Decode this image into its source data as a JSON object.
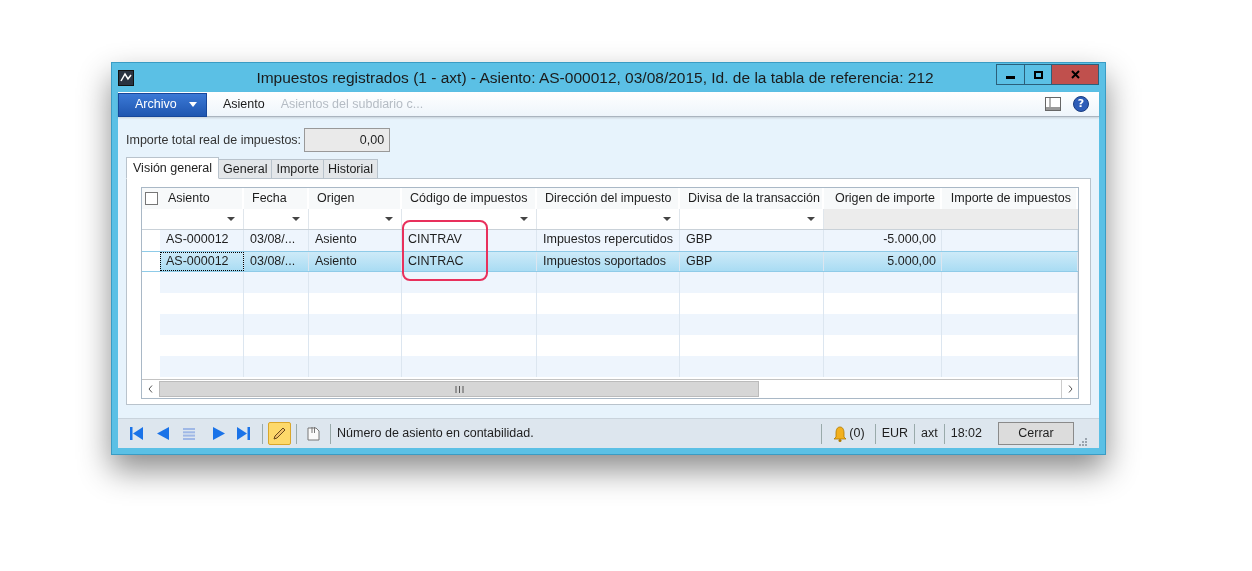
{
  "window": {
    "title": "Impuestos registrados (1 - axt) - Asiento: AS-000012, 03/08/2015, Id. de la tabla de referencia: 212"
  },
  "help_button": "?",
  "menu": [
    {
      "label": "Archivo",
      "kind": "file"
    },
    {
      "label": "Asiento",
      "kind": "item",
      "disabled": false
    },
    {
      "label": "Asientos del subdiario c...",
      "kind": "item",
      "disabled": true
    }
  ],
  "total": {
    "label": "Importe total real de impuestos:",
    "value": "0,00"
  },
  "tabs": [
    {
      "label": "Visión general",
      "selected": true
    },
    {
      "label": "General",
      "selected": false
    },
    {
      "label": "Importe",
      "selected": false
    },
    {
      "label": "Historial",
      "selected": false
    }
  ],
  "table": {
    "columns": [
      {
        "label": "Asiento",
        "filter": true,
        "kind": "text"
      },
      {
        "label": "Fecha",
        "filter": true,
        "kind": "text"
      },
      {
        "label": "Origen",
        "filter": true,
        "kind": "text"
      },
      {
        "label": "Código de impuestos",
        "filter": true,
        "kind": "text"
      },
      {
        "label": "Dirección del impuesto",
        "filter": true,
        "kind": "text"
      },
      {
        "label": "Divisa de la transacción",
        "filter": true,
        "kind": "text"
      },
      {
        "label": "Origen de importe",
        "filter": false,
        "kind": "amount"
      },
      {
        "label": "Importe de impuestos",
        "filter": false,
        "kind": "amount"
      }
    ],
    "select_all": {
      "checked": false
    },
    "rows": [
      {
        "selected": false,
        "cells": [
          "AS-000012",
          "03/08/...",
          "Asiento",
          "CINTRAV",
          "Impuestos repercutidos",
          "GBP",
          "-5.000,00"
        ]
      },
      {
        "selected": true,
        "cells": [
          "AS-000012",
          "03/08/...",
          "Asiento",
          "CINTRAC",
          "Impuestos soportados",
          "GBP",
          "5.000,00"
        ]
      }
    ]
  },
  "status_bar": {
    "edit_mode": true,
    "message": "Número de asiento en contabilidad.",
    "alerts": "(0)",
    "currency": "EUR",
    "company": "axt",
    "time": "18:02",
    "close_button": "Cerrar"
  }
}
